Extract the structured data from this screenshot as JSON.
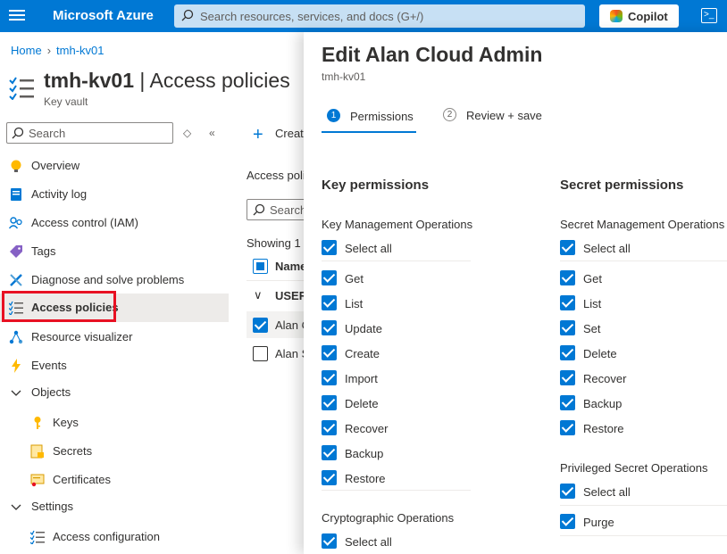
{
  "topbar": {
    "brand": "Microsoft Azure",
    "search_placeholder": "Search resources, services, and docs (G+/)",
    "copilot_label": "Copilot",
    "accent": "#0078d4"
  },
  "breadcrumb": {
    "home": "Home",
    "resource": "tmh-kv01"
  },
  "resource": {
    "name": "tmh-kv01",
    "page": "Access policies",
    "type": "Key vault"
  },
  "sidebar": {
    "search_placeholder": "Search",
    "items": [
      {
        "label": "Overview",
        "icon": "overview-icon"
      },
      {
        "label": "Activity log",
        "icon": "activity-log-icon"
      },
      {
        "label": "Access control (IAM)",
        "icon": "access-control-icon"
      },
      {
        "label": "Tags",
        "icon": "tag-icon"
      },
      {
        "label": "Diagnose and solve problems",
        "icon": "wrench-icon"
      },
      {
        "label": "Access policies",
        "icon": "access-policies-icon",
        "active": true
      },
      {
        "label": "Resource visualizer",
        "icon": "resource-visualizer-icon"
      },
      {
        "label": "Events",
        "icon": "lightning-icon"
      },
      {
        "label": "Objects",
        "icon": "chevron-down-icon",
        "group": true
      },
      {
        "label": "Keys",
        "icon": "key-icon",
        "sub": true
      },
      {
        "label": "Secrets",
        "icon": "secret-icon",
        "sub": true
      },
      {
        "label": "Certificates",
        "icon": "certificate-icon",
        "sub": true
      },
      {
        "label": "Settings",
        "icon": "chevron-down-icon",
        "group": true
      },
      {
        "label": "Access configuration",
        "icon": "access-config-icon",
        "sub": true
      }
    ]
  },
  "main": {
    "create_label": "Create",
    "access_label": "Access poli",
    "search_placeholder": "Search",
    "showing": "Showing 1",
    "name_header": "Name",
    "group_label": "USER",
    "rows": [
      "Alan C",
      "Alan S"
    ]
  },
  "panel": {
    "title": "Edit Alan Cloud Admin",
    "subtitle": "tmh-kv01",
    "steps": [
      {
        "num": "1",
        "label": "Permissions",
        "active": true
      },
      {
        "num": "2",
        "label": "Review + save",
        "active": false
      }
    ],
    "key_permissions": {
      "heading": "Key permissions",
      "management_label": "Key Management Operations",
      "select_all": "Select all",
      "items": [
        "Get",
        "List",
        "Update",
        "Create",
        "Import",
        "Delete",
        "Recover",
        "Backup",
        "Restore"
      ],
      "crypto_label": "Cryptographic Operations",
      "crypto_select_all": "Select all"
    },
    "secret_permissions": {
      "heading": "Secret permissions",
      "management_label": "Secret Management Operations",
      "select_all": "Select all",
      "items": [
        "Get",
        "List",
        "Set",
        "Delete",
        "Recover",
        "Backup",
        "Restore"
      ],
      "privileged_label": "Privileged Secret Operations",
      "privileged_select_all": "Select all",
      "privileged_items": [
        "Purge"
      ]
    }
  }
}
